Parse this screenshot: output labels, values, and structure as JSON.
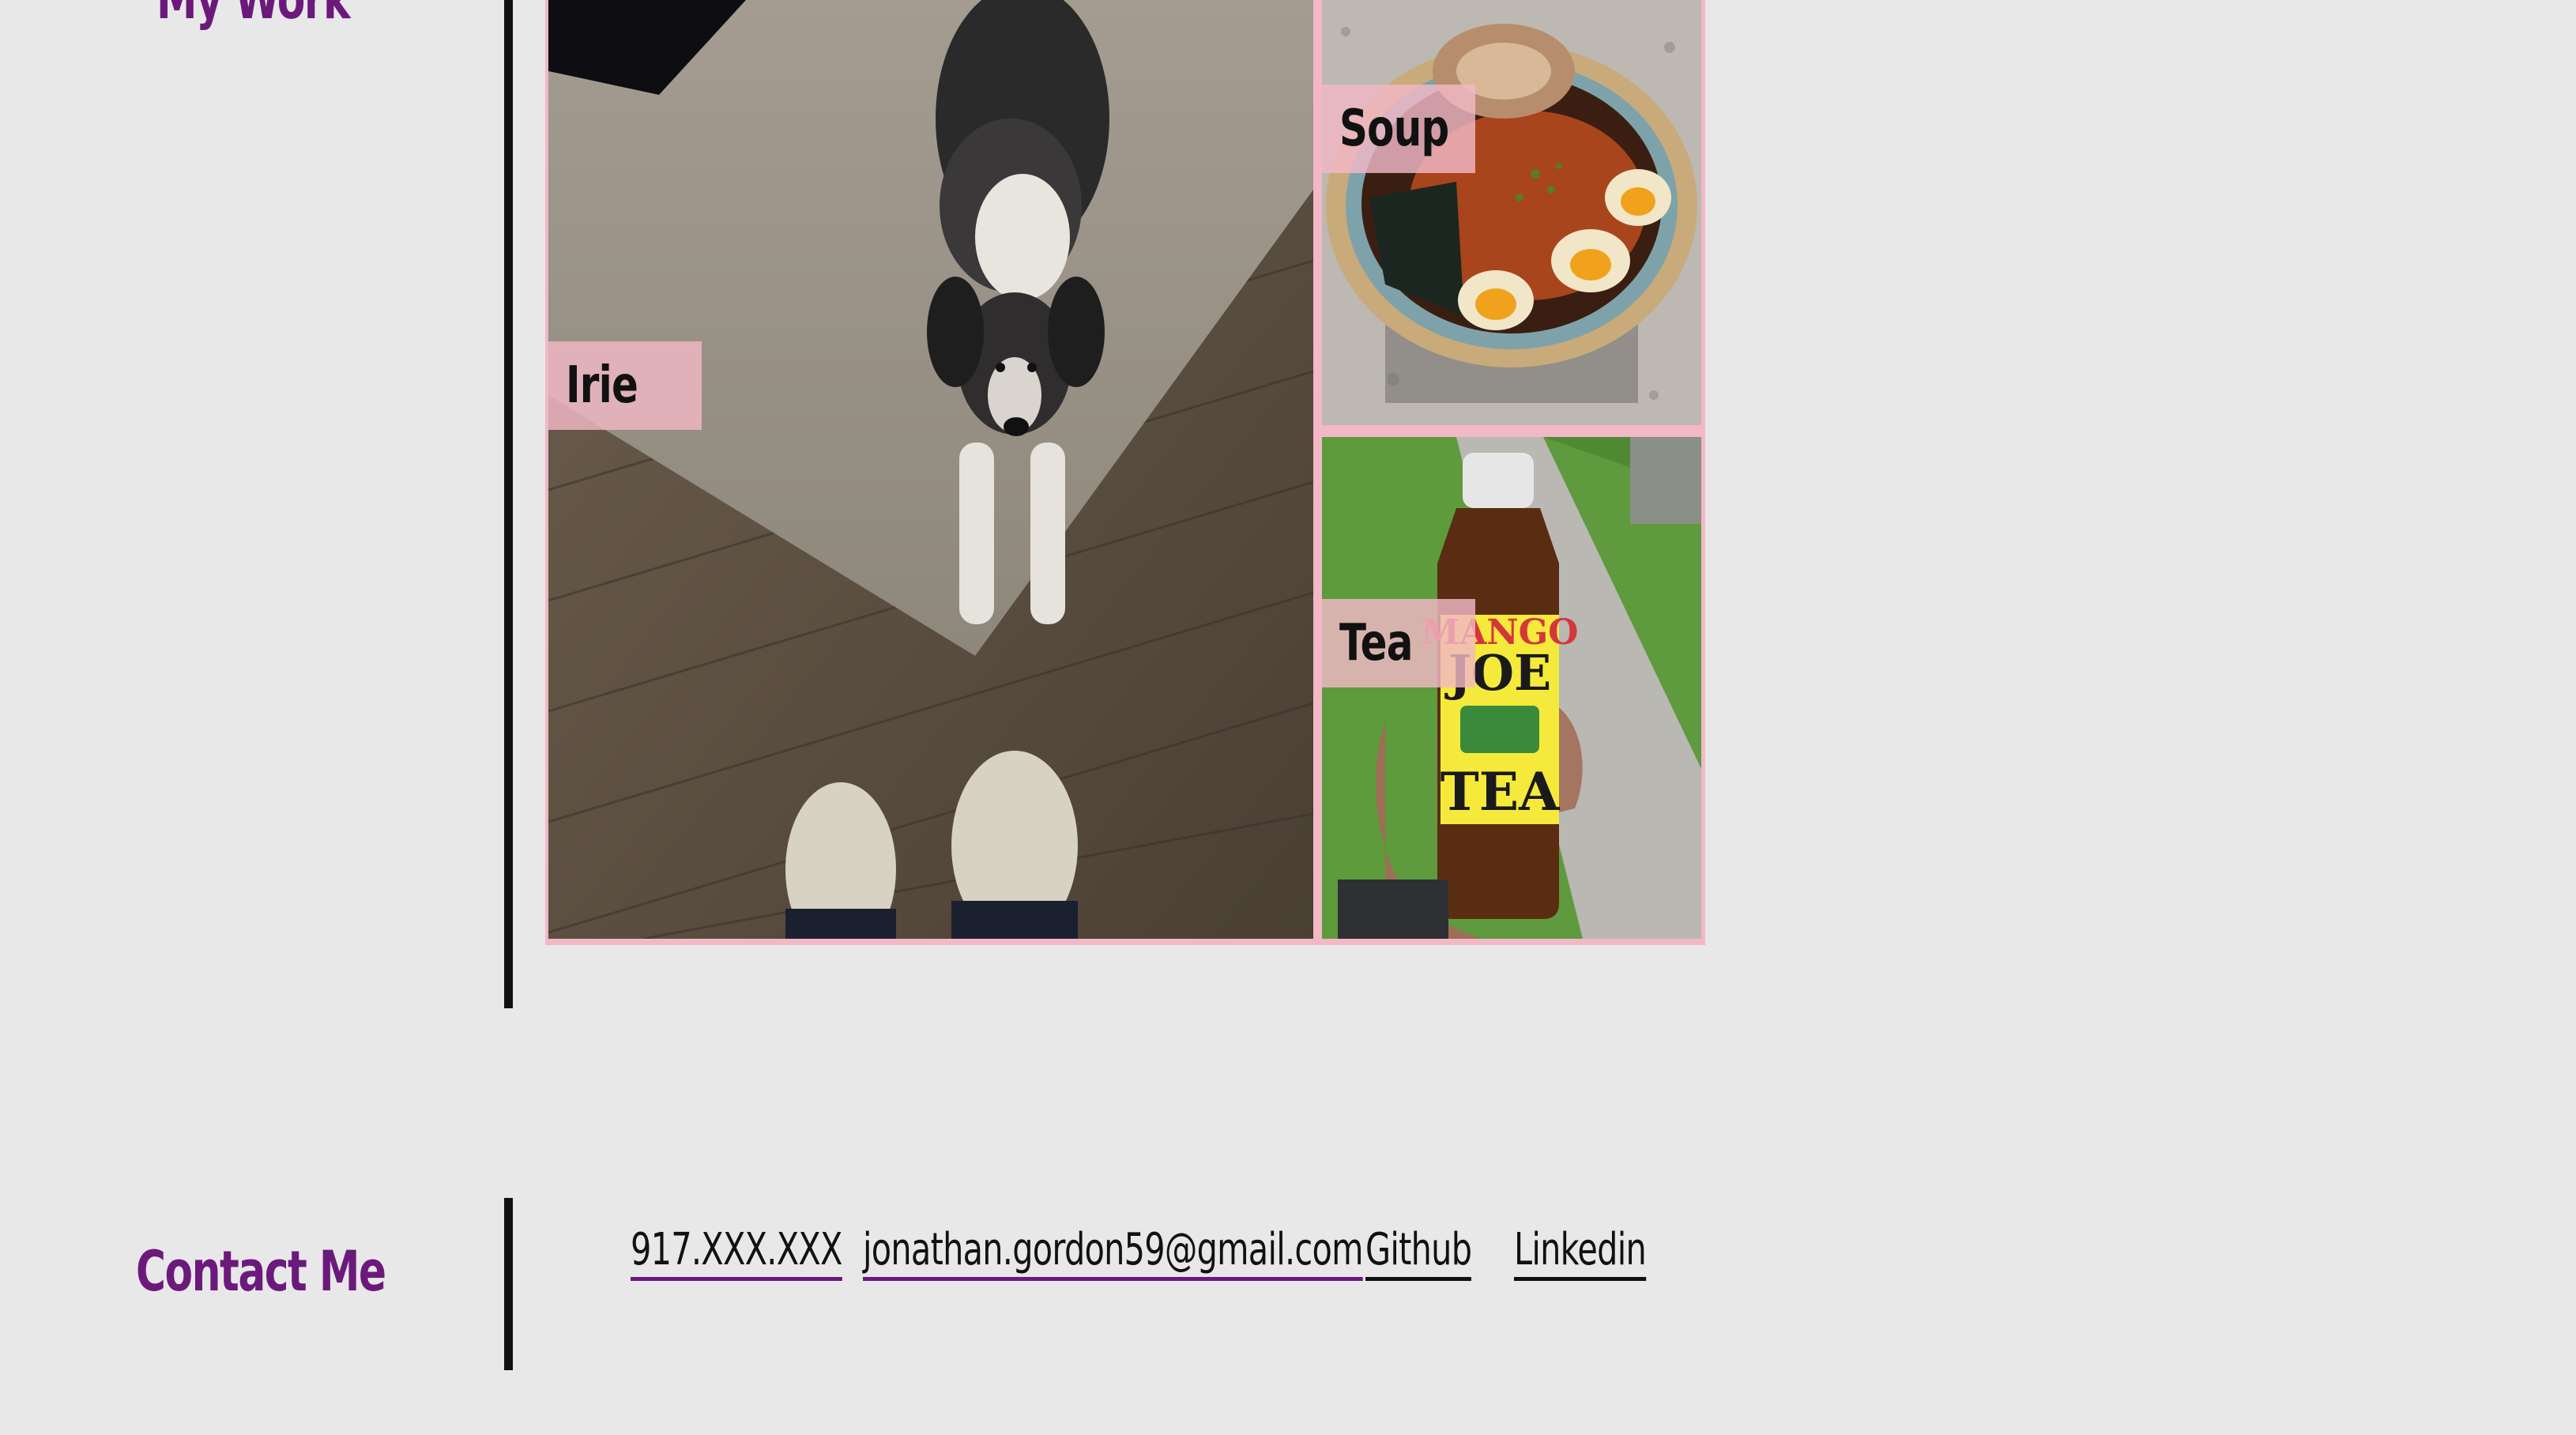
{
  "sections": {
    "work_title": "My Work",
    "contact_title": "Contact Me"
  },
  "gallery": {
    "items": [
      {
        "label": "Irie",
        "image": "dog-photo"
      },
      {
        "label": "Soup",
        "image": "ramen-photo"
      },
      {
        "label": "Tea",
        "image": "mango-tea-photo"
      }
    ],
    "tea_bottle": {
      "brand_line1": "MANGO",
      "brand_line2": "JOE",
      "brand_line3": "TEA"
    }
  },
  "contact": {
    "phone": "917.XXX.XXX",
    "email": "jonathan.gordon59@gmail.com",
    "github": "Github",
    "linkedin": "Linkedin"
  },
  "colors": {
    "background": "#e8e8e8",
    "accent_purple": "#6b1a7c",
    "tag_pink": "#f2b8c6",
    "divider": "#111111"
  }
}
